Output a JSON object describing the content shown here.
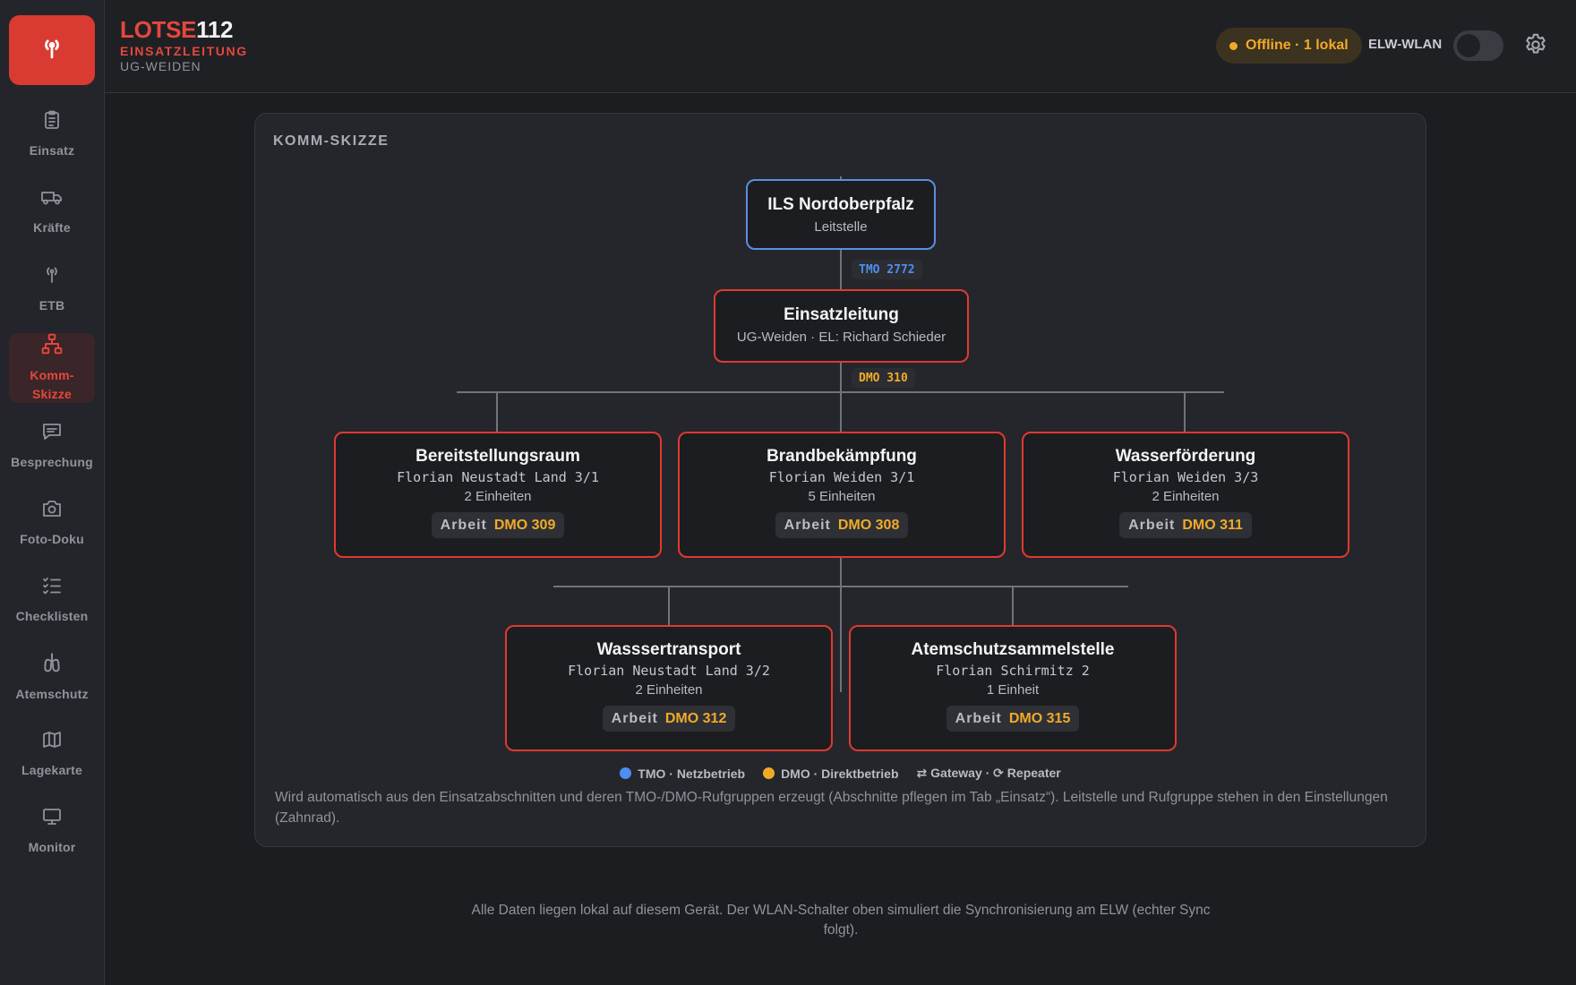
{
  "app": {
    "brand_red": "LOTSE",
    "brand_white": "112",
    "subtitle": "EINSATZLEITUNG",
    "unit": "UG-WEIDEN"
  },
  "sidebar": {
    "items": [
      {
        "label": "Einsatz",
        "icon": "clipboard-icon"
      },
      {
        "label": "Kräfte",
        "icon": "truck-icon"
      },
      {
        "label": "ETB",
        "icon": "antenna-icon"
      },
      {
        "label": "Komm-Skizze",
        "label_line1": "Komm-",
        "label_line2": "Skizze",
        "icon": "network-icon",
        "active": true
      },
      {
        "label": "Besprechung",
        "icon": "chat-icon"
      },
      {
        "label": "Foto-Doku",
        "icon": "camera-icon"
      },
      {
        "label": "Checklisten",
        "icon": "checklist-icon"
      },
      {
        "label": "Atemschutz",
        "icon": "lungs-icon"
      },
      {
        "label": "Lagekarte",
        "icon": "map-icon"
      },
      {
        "label": "Monitor",
        "icon": "monitor-icon"
      }
    ]
  },
  "header": {
    "status": "Offline · 1 lokal",
    "wlan_label": "ELW-WLAN",
    "wlan_on": false
  },
  "panel": {
    "title": "KOMM-SKIZZE",
    "root": {
      "title": "ILS Nordoberpfalz",
      "subtitle": "Leitstelle"
    },
    "tmo_tag": "TMO 2772",
    "command": {
      "title": "Einsatzleitung",
      "subtitle": "UG-Weiden · EL: Richard Schieder"
    },
    "dmo_tag": "DMO 310",
    "sections": [
      {
        "title": "Bereitstellungsraum",
        "callsign": "Florian Neustadt Land 3/1",
        "count": "2 Einheiten",
        "chip_label": "Arbeit",
        "chip_value": "DMO 309"
      },
      {
        "title": "Brandbekämpfung",
        "callsign": "Florian Weiden 3/1",
        "count": "5 Einheiten",
        "chip_label": "Arbeit",
        "chip_value": "DMO 308"
      },
      {
        "title": "Wasserförderung",
        "callsign": "Florian Weiden 3/3",
        "count": "2 Einheiten",
        "chip_label": "Arbeit",
        "chip_value": "DMO 311"
      },
      {
        "title": "Wasssertransport",
        "callsign": "Florian Neustadt Land 3/2",
        "count": "2 Einheiten",
        "chip_label": "Arbeit",
        "chip_value": "DMO 312"
      },
      {
        "title": "Atemschutzsammelstelle",
        "callsign": "Florian Schirmitz 2",
        "count": "1 Einheit",
        "chip_label": "Arbeit",
        "chip_value": "DMO 315"
      }
    ],
    "legend": {
      "tmo": "TMO · Netzbetrieb",
      "dmo": "DMO · Direktbetrieb",
      "gateway": "⇄ Gateway · ⟳ Repeater"
    },
    "note": "Wird automatisch aus den Einsatzabschnitten und deren TMO-/DMO-Rufgruppen erzeugt (Abschnitte pflegen im Tab „Einsatz“). Leitstelle und Rufgruppe stehen in den Einstellungen (Zahnrad)."
  },
  "footer": "Alle Daten liegen lokal auf diesem Gerät. Der WLAN-Schalter oben simuliert die Synchronisierung am ELW (echter Sync folgt).",
  "colors": {
    "accent_red": "#e0392f",
    "tmo_blue": "#4d8ef0",
    "dmo_orange": "#f1aa28"
  }
}
